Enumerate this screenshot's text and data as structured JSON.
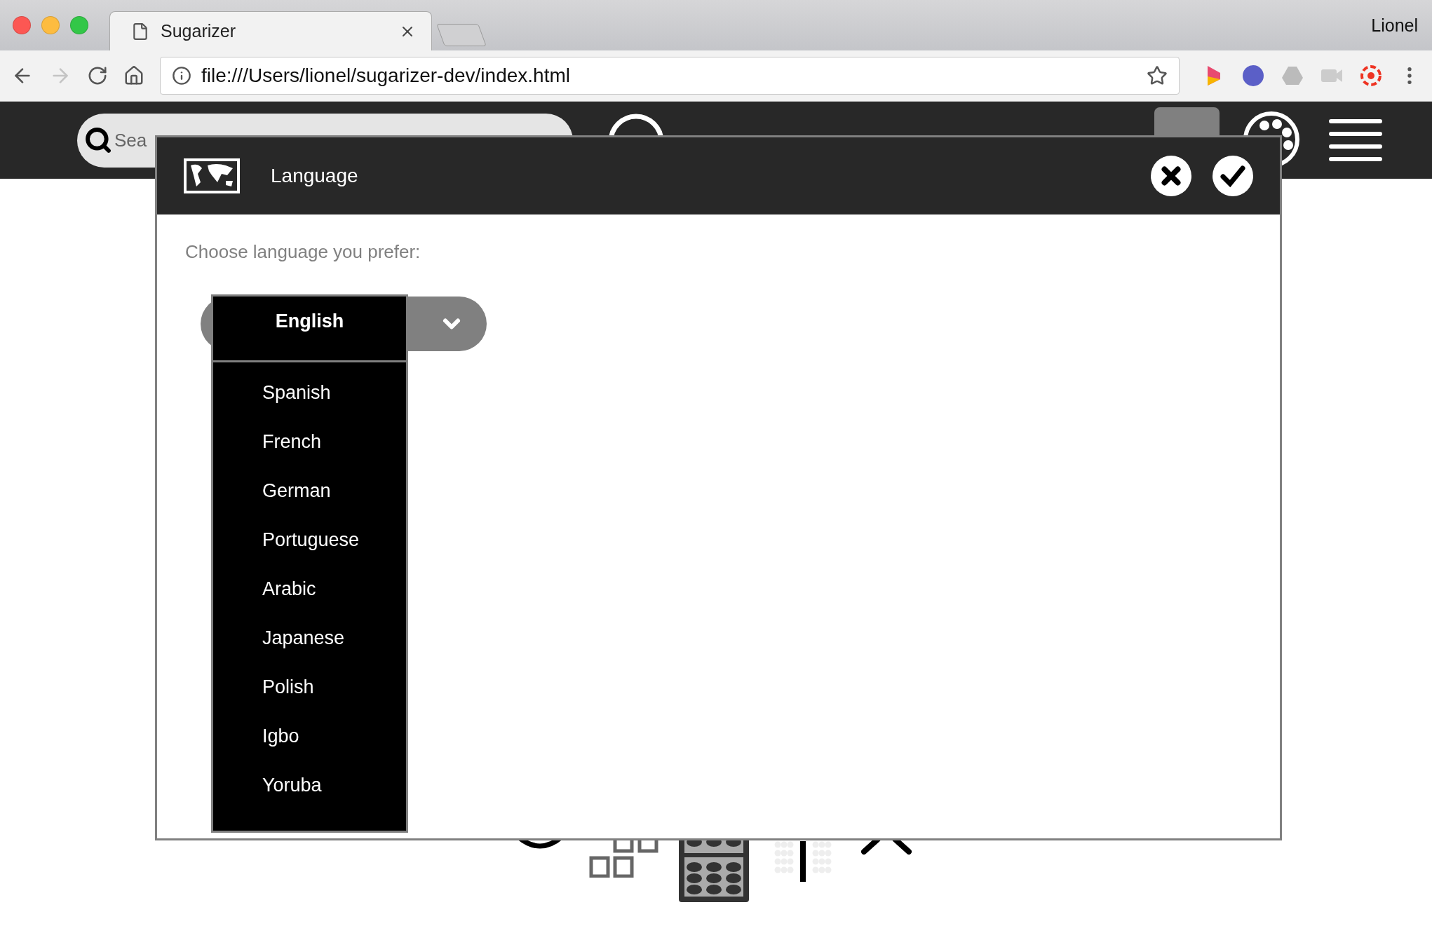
{
  "browser": {
    "tab_title": "Sugarizer",
    "profile": "Lionel",
    "url": "file:///Users/lionel/sugarizer-dev/index.html"
  },
  "toolbar": {
    "search": {
      "placeholder": "Sea"
    }
  },
  "dialog": {
    "title": "Language",
    "prompt": "Choose language you prefer:",
    "languages": [
      {
        "label": "English",
        "selected": true
      },
      {
        "label": "Spanish",
        "selected": false
      },
      {
        "label": "French",
        "selected": false
      },
      {
        "label": "German",
        "selected": false
      },
      {
        "label": "Portuguese",
        "selected": false
      },
      {
        "label": "Arabic",
        "selected": false
      },
      {
        "label": "Japanese",
        "selected": false
      },
      {
        "label": "Polish",
        "selected": false
      },
      {
        "label": "Igbo",
        "selected": false
      },
      {
        "label": "Yoruba",
        "selected": false
      }
    ]
  }
}
